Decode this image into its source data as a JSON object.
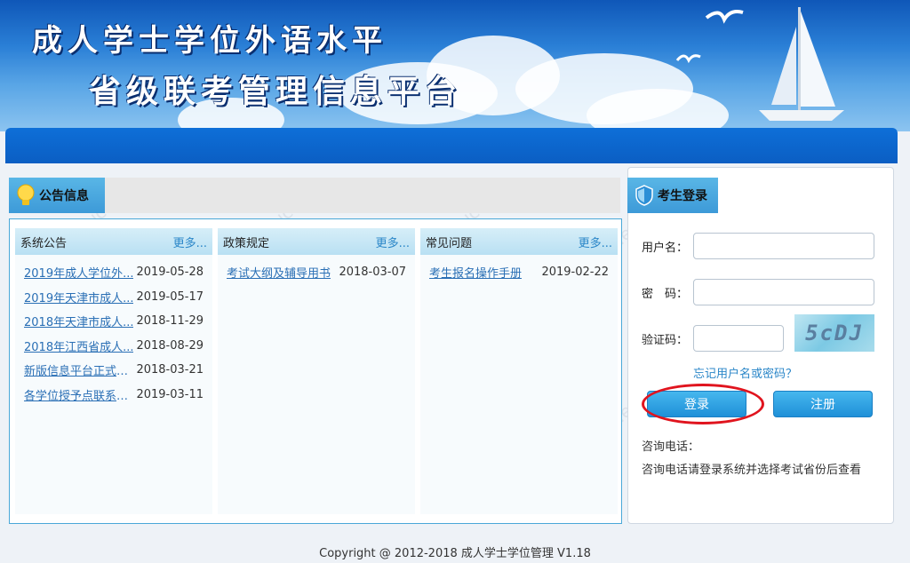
{
  "banner": {
    "title_line1": "成人学士学位外语水平",
    "title_line2": "省级联考管理信息平台"
  },
  "notice": {
    "tab_label": "公告信息",
    "columns": [
      {
        "title": "系统公告",
        "more": "更多...",
        "items": [
          {
            "title": "2019年成人学位外...",
            "date": "2019-05-28"
          },
          {
            "title": "2019年天津市成人...",
            "date": "2019-05-17"
          },
          {
            "title": "2018年天津市成人...",
            "date": "2018-11-29"
          },
          {
            "title": "2018年江西省成人...",
            "date": "2018-08-29"
          },
          {
            "title": "新版信息平台正式启用",
            "date": "2018-03-21"
          },
          {
            "title": "各学位授予点联系电话...",
            "date": "2019-03-11"
          }
        ]
      },
      {
        "title": "政策规定",
        "more": "更多...",
        "items": [
          {
            "title": "考试大纲及辅导用书",
            "date": "2018-03-07"
          }
        ]
      },
      {
        "title": "常见问题",
        "more": "更多...",
        "items": [
          {
            "title": "考生报名操作手册",
            "date": "2019-02-22"
          }
        ]
      }
    ]
  },
  "login": {
    "tab_label": "考生登录",
    "username_label": "用户名：",
    "password_label": "密　码：",
    "captcha_label": "验证码：",
    "captcha_text": "5cDJ",
    "forgot_link": "忘记用户名或密码？",
    "login_button": "登录",
    "register_button": "注册",
    "hotline_label": "咨询电话：",
    "hotline_text": "咨询电话请登录系统并选择考试省份后查看"
  },
  "footer": {
    "copyright": "Copyright @ 2012-2018 成人学士学位管理 V1.18"
  },
  "watermark": {
    "text": "www.educity.cn",
    "brand": "希赛网"
  },
  "colors": {
    "banner_blue": "#0f57b8",
    "nav_blue": "#0b5ec3",
    "tab_blue": "#3d9ad8",
    "link_blue": "#2a6fb5",
    "highlight_red": "#e0141e"
  }
}
